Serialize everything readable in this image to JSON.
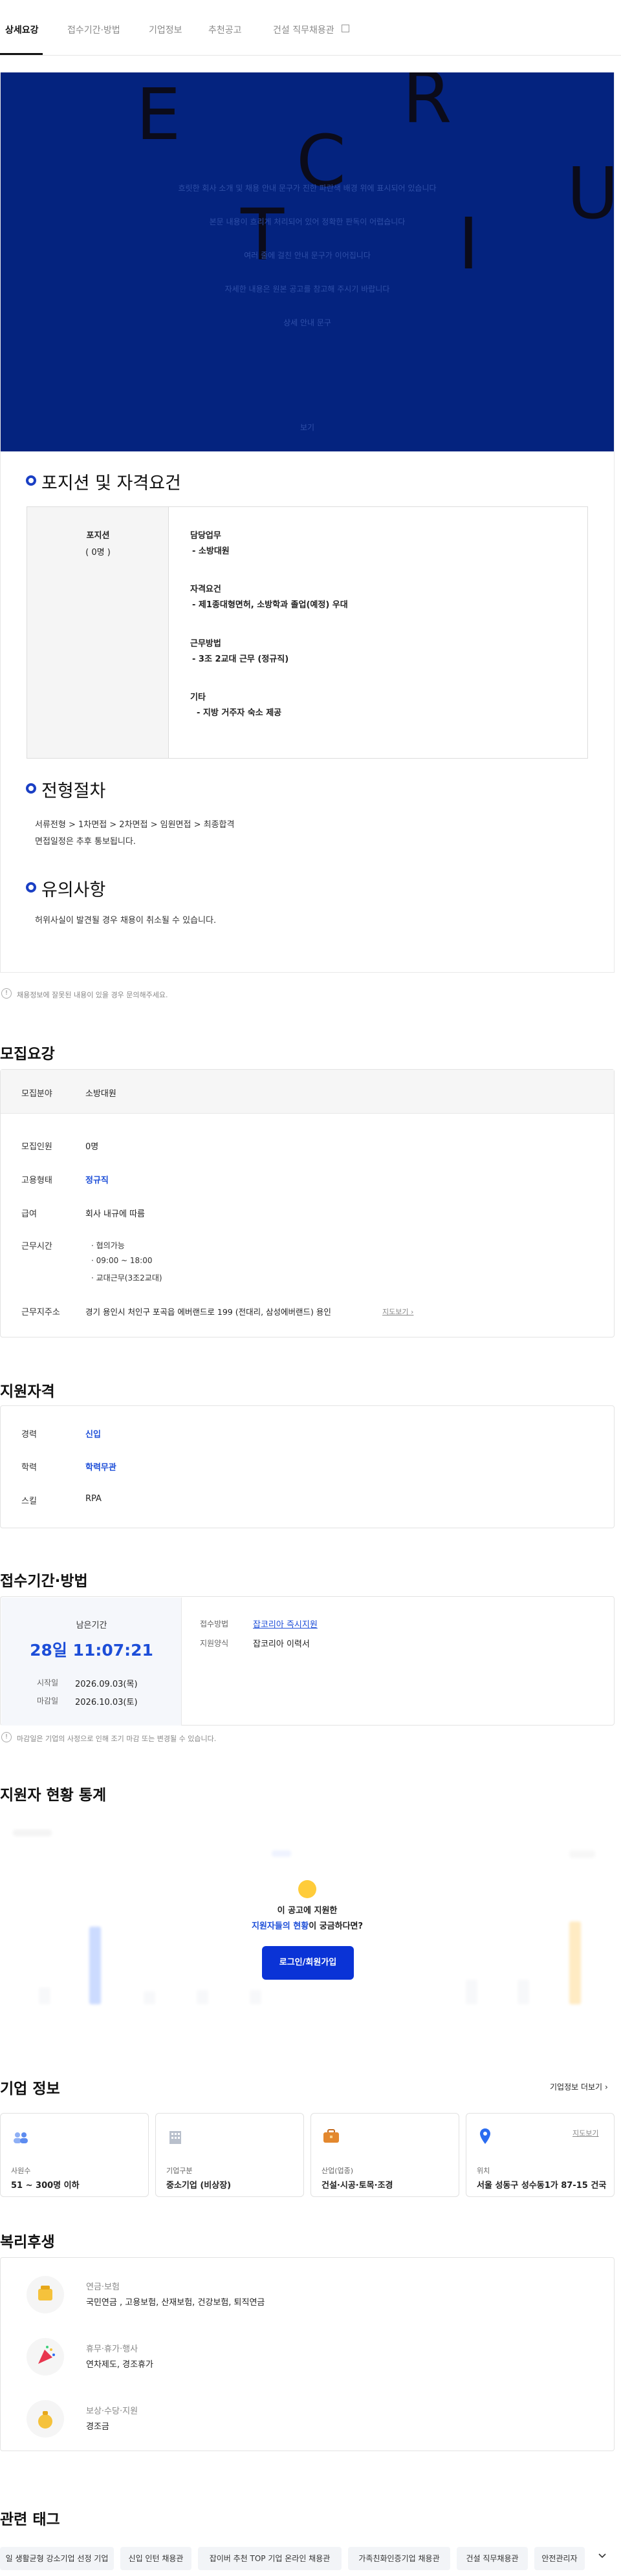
{
  "tabs": [
    {
      "label": "상세요강"
    },
    {
      "label": "접수기간·방법"
    },
    {
      "label": "기업정보"
    },
    {
      "label": "추천공고"
    },
    {
      "label": "건설 직무채용관"
    }
  ],
  "hero": {
    "letters": [
      "E",
      "R",
      "C",
      "U",
      "T",
      "I"
    ],
    "lines": [
      "흐릿한 회사 소개 및 채용 안내 문구가 진한 파란색 배경 위에 표시되어 있습니다",
      "본문 내용이 흐리게 처리되어 있어 정확한 판독이 어렵습니다",
      "여러 줄에 걸친 안내 문구가 이어집니다",
      "자세한 내용은 원본 공고를 참고해 주시기 바랍니다",
      "상세 안내 문구"
    ],
    "bottom_link": "보기"
  },
  "position": {
    "title": "포지션 및 자격요건",
    "label": "포지션",
    "count": "( 0명 )",
    "items": [
      {
        "heading": "담당업무",
        "value": "- 소방대원"
      },
      {
        "heading": "자격요건",
        "value": "- 제1종대형면허, 소방학과 졸업(예정) 우대"
      },
      {
        "heading": "근무방법",
        "value": "- 3조 2교대 근무 (정규직)"
      },
      {
        "heading": "기타",
        "value": "- 지방 거주자 숙소 제공"
      }
    ]
  },
  "process": {
    "title": "전형절차",
    "steps": "서류전형 > 1차면접 > 2차면접 > 임원면접 > 최종합격",
    "note": "면접일정은 추후 통보됩니다."
  },
  "caution": {
    "title": "유의사항",
    "text": "허위사실이 발견될 경우 채용이 취소될 수 있습니다."
  },
  "report_note": "채용정보에 잘못된 내용이 있을 경우 문의해주세요.",
  "summary": {
    "title": "모집요강",
    "field_label": "모집분야",
    "field_value": "소방대원",
    "rows": [
      {
        "label": "모집인원",
        "value": "0명"
      },
      {
        "label": "고용형태",
        "value": "정규직"
      },
      {
        "label": "급여",
        "value": "회사 내규에 따름"
      }
    ],
    "hours_label": "근무시간",
    "hours": [
      "협의가능",
      "09:00 ~ 18:00",
      "교대근무(3조2교대)"
    ],
    "address_label": "근무지주소",
    "address": "경기 용인시 처인구 포곡읍 에버랜드로 199 (전대리, 삼성에버랜드) 용인",
    "map_link": "지도보기"
  },
  "qualification": {
    "title": "지원자격",
    "rows": [
      {
        "label": "경력",
        "value": "신입"
      },
      {
        "label": "학력",
        "value": "학력무관"
      },
      {
        "label": "스킬",
        "value": "RPA"
      }
    ]
  },
  "apply": {
    "title": "접수기간·방법",
    "remaining_label": "남은기간",
    "remaining": "28일 11:07:21",
    "start_label": "시작일",
    "start": "2026.09.03(목)",
    "end_label": "마감일",
    "end": "2026.10.03(토)",
    "method_label": "접수방법",
    "method": "잡코리아 즉시지원",
    "form_label": "지원양식",
    "form": "잡코리아 이력서",
    "note": "마감일은 기업의 사정으로 인해 조기 마감 또는 변경될 수 있습니다."
  },
  "stats": {
    "title": "지원자 현황 통계",
    "question_line1": "이 공고에 지원한",
    "question_highlight": "지원자들의 현황",
    "question_suffix": "이 궁금하다면?",
    "login_button": "로그인/회원가입"
  },
  "company": {
    "title": "기업 정보",
    "more_link": "기업정보 더보기",
    "map_link": "지도보기",
    "cards": [
      {
        "label": "사원수",
        "value": "51 ~ 300명 이하"
      },
      {
        "label": "기업구분",
        "value": "중소기업 (비상장)"
      },
      {
        "label": "산업(업종)",
        "value": "건설·시공·토목·조경"
      },
      {
        "label": "위치",
        "value": "서울 성동구 성수동1가 87-15 건국..."
      }
    ]
  },
  "welfare": {
    "title": "복리후생",
    "items": [
      {
        "category": "연금·보험",
        "value": "국민연금 , 고용보험, 산재보험, 건강보험, 퇴직연금"
      },
      {
        "category": "휴무·휴가·행사",
        "value": "연차제도, 경조휴가"
      },
      {
        "category": "보상·수당·지원",
        "value": "경조금"
      }
    ]
  },
  "tags": {
    "title": "관련 태그",
    "items": [
      "일 생활균형 강소기업 선정 기업",
      "신입 인턴 채용관",
      "잡이버 추천 TOP 기업 온라인 채용관",
      "가족친화인증기업 채용관",
      "건설 직무채용관",
      "안전관리자"
    ]
  },
  "colors": {
    "brand_blue": "#0a33d6",
    "hero_bg": "#04237f",
    "link_blue": "#1d4ed8"
  }
}
